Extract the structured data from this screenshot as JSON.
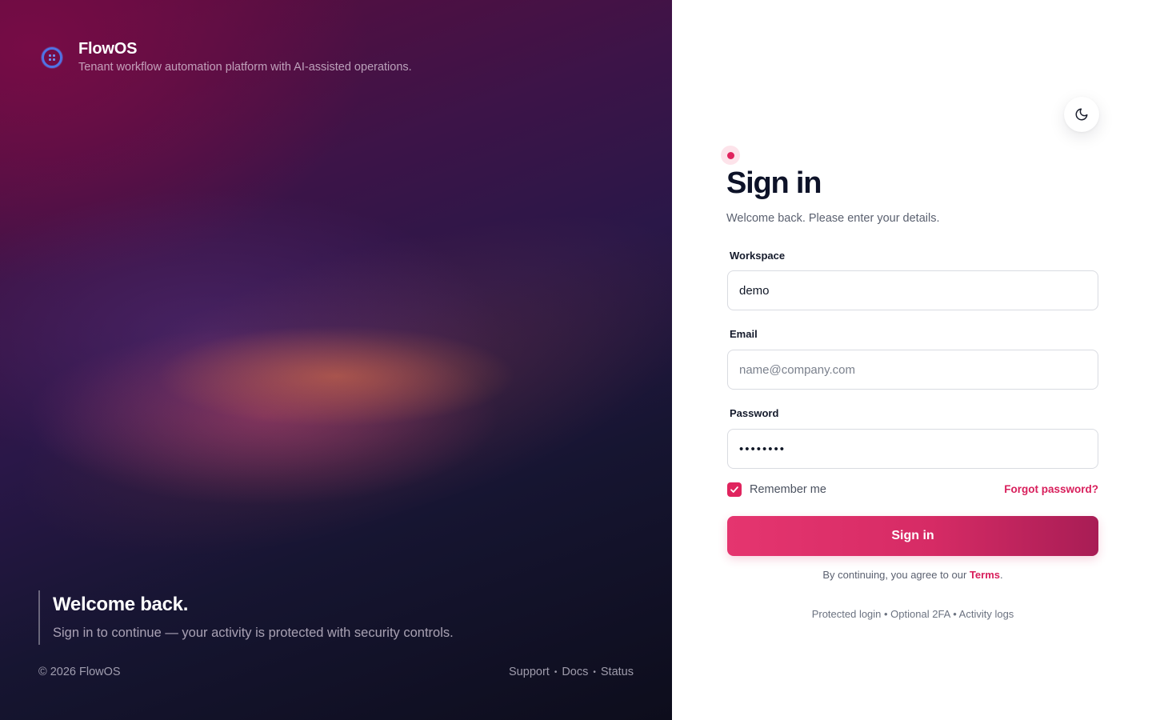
{
  "brand": {
    "name": "FlowOS",
    "tagline": "Tenant workflow automation platform with AI-assisted operations."
  },
  "hero": {
    "welcome_title": "Welcome back.",
    "welcome_subtitle": "Sign in to continue — your activity is protected with security controls.",
    "copyright": "© 2026 FlowOS",
    "links": [
      "Support",
      "Docs",
      "Status"
    ],
    "link_separator": "•"
  },
  "form": {
    "title": "Sign in",
    "subtitle": "Welcome back. Please enter your details.",
    "workspace": {
      "label": "Workspace",
      "value": "demo",
      "placeholder": ""
    },
    "email": {
      "label": "Email",
      "value": "",
      "placeholder": "name@company.com"
    },
    "password": {
      "label": "Password",
      "value": "••••••••"
    },
    "remember": {
      "label": "Remember me",
      "checked": true
    },
    "forgot_label": "Forgot password?",
    "submit_label": "Sign in",
    "terms_prefix": "By continuing, you agree to our",
    "terms_link": "Terms",
    "terms_suffix": ".",
    "trust_line": "Protected login • Optional 2FA • Activity logs"
  },
  "icons": {
    "theme_toggle": "moon-icon",
    "brand_logo": "grid-logo-icon",
    "checkbox": "check-icon"
  },
  "colors": {
    "accent": "#e0245e",
    "accent_dark": "#a81d55",
    "hero_dark": "#0d0d1c",
    "heading": "#0d1228"
  }
}
